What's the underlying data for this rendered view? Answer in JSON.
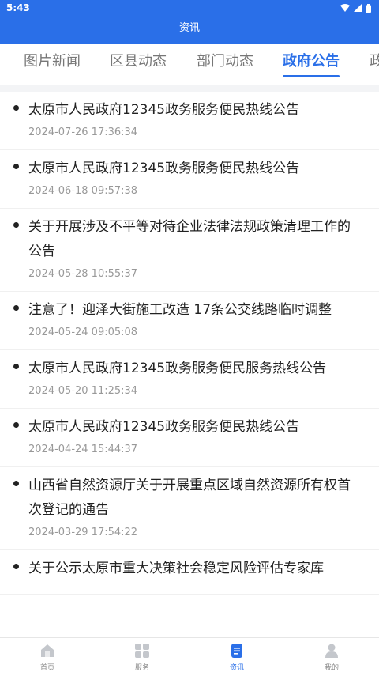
{
  "status_bar": {
    "time": "5:43"
  },
  "header": {
    "title": "资讯"
  },
  "tabs": [
    {
      "label": "图片新闻",
      "active": false
    },
    {
      "label": "区县动态",
      "active": false
    },
    {
      "label": "部门动态",
      "active": false
    },
    {
      "label": "政府公告",
      "active": true
    },
    {
      "label": "政",
      "active": false
    }
  ],
  "items": [
    {
      "title": "太原市人民政府12345政务服务便民热线公告",
      "time": "2024-07-26 17:36:34"
    },
    {
      "title": "太原市人民政府12345政务服务便民热线公告",
      "time": "2024-06-18 09:57:38"
    },
    {
      "title": "关于开展涉及不平等对待企业法律法规政策清理工作的公告",
      "time": "2024-05-28 10:55:37"
    },
    {
      "title": "注意了！迎泽大街施工改造 17条公交线路临时调整",
      "time": "2024-05-24 09:05:08"
    },
    {
      "title": "太原市人民政府12345政务服务便民服务热线公告",
      "time": "2024-05-20 11:25:34"
    },
    {
      "title": "太原市人民政府12345政务服务便民热线公告",
      "time": "2024-04-24 15:44:37"
    },
    {
      "title": "山西省自然资源厅关于开展重点区域自然资源所有权首次登记的通告",
      "time": "2024-03-29 17:54:22"
    },
    {
      "title": "关于公示太原市重大决策社会稳定风险评估专家库",
      "time": ""
    }
  ],
  "bottom_nav": [
    {
      "label": "首页",
      "icon": "home-icon",
      "active": false
    },
    {
      "label": "服务",
      "icon": "grid-icon",
      "active": false
    },
    {
      "label": "资讯",
      "icon": "document-icon",
      "active": true
    },
    {
      "label": "我的",
      "icon": "user-icon",
      "active": false
    }
  ],
  "colors": {
    "accent": "#2a6fe8",
    "text": "#222222",
    "muted": "#999999"
  }
}
